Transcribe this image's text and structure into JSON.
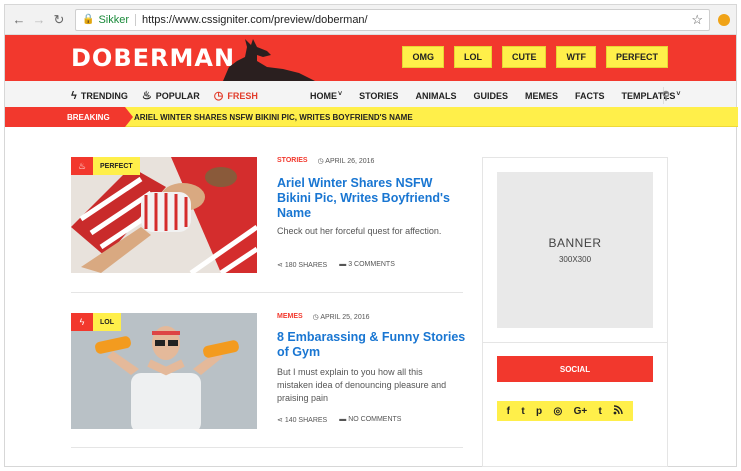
{
  "browser": {
    "secure_label": "Sikker",
    "url": "https://www.cssigniter.com/preview/doberman/"
  },
  "header": {
    "logo_text": "DOBERMAN",
    "logo_dot": ".",
    "tags": [
      "OMG",
      "LOL",
      "CUTE",
      "WTF",
      "PERFECT"
    ]
  },
  "nav": {
    "left": [
      {
        "label": "TRENDING",
        "icon": "lightning-icon"
      },
      {
        "label": "POPULAR",
        "icon": "flame-icon"
      },
      {
        "label": "FRESH",
        "icon": "clock-icon"
      }
    ],
    "menu": [
      "HOME",
      "STORIES",
      "ANIMALS",
      "GUIDES",
      "MEMES",
      "FACTS",
      "TEMPLATES"
    ]
  },
  "breaking": {
    "label": "BREAKING",
    "headline": "ARIEL WINTER SHARES NSFW BIKINI PIC, WRITES BOYFRIEND'S NAME"
  },
  "posts": [
    {
      "badge": "PERFECT",
      "category": "STORIES",
      "date": "APRIL 26, 2016",
      "title": "Ariel Winter Shares NSFW Bikini Pic, Writes Boyfriend's Name",
      "excerpt": "Check out her forceful quest for affection.",
      "shares": "180 SHARES",
      "comments": "3 COMMENTS"
    },
    {
      "badge": "LOL",
      "category": "MEMES",
      "date": "APRIL 25, 2016",
      "title": "8 Embarassing & Funny Stories of Gym",
      "excerpt": "But I must explain to you how all this mistaken idea of denouncing pleasure and praising pain",
      "shares": "140 SHARES",
      "comments": "NO COMMENTS"
    }
  ],
  "sidebar": {
    "banner_title": "BANNER",
    "banner_size": "300X300",
    "social_title": "SOCIAL",
    "social_icons": [
      "f",
      "t",
      "p",
      "◎",
      "G+",
      "t",
      "rss"
    ]
  },
  "colors": {
    "brand_red": "#f2382d",
    "accent_yellow": "#ffef4a",
    "link_blue": "#1976d2"
  }
}
